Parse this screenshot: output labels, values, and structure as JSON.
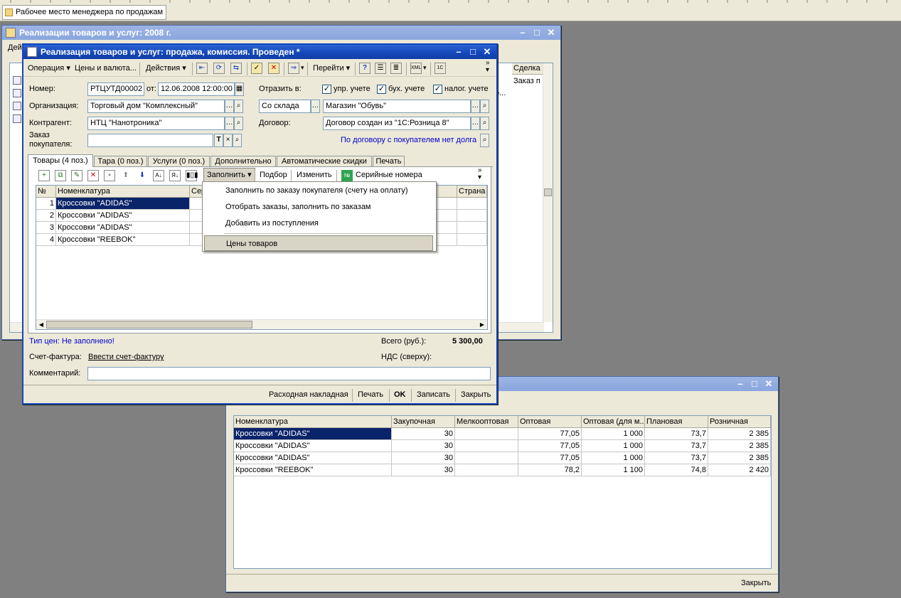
{
  "workplace_tab": "Рабочее место менеджера по продажам",
  "back_window": {
    "title": "Реализации товаров и услуг: 2008 г.",
    "menu_stub": "Дей",
    "col_deal": "Сделка",
    "deal_value": "Заказ п",
    "partial_text": "о..."
  },
  "main_window": {
    "title": "Реализация товаров и услуг: продажа, комиссия. Проведен *",
    "toolbar": {
      "operation": "Операция",
      "prices_currency": "Цены и валюта...",
      "actions": "Действия",
      "goto": "Перейти"
    },
    "form": {
      "number_label": "Номер:",
      "number_value": "РТЦУТД00002",
      "date_label": "от:",
      "date_value": "12.06.2008 12:00:00",
      "reflect_label": "Отразить в:",
      "check_mgmt": "упр. учете",
      "check_acc": "бух. учете",
      "check_tax": "налог. учете",
      "org_label": "Организация:",
      "org_value": "Торговый дом \"Комплексный\"",
      "warehouse_mode": "Со склада",
      "warehouse_value": "Магазин \"Обувь\"",
      "contractor_label": "Контрагент:",
      "contractor_value": "НТЦ \"Нанотроника\"",
      "contract_label": "Договор:",
      "contract_value": "Договор создан из \"1С:Розница 8\"",
      "order_label_1": "Заказ",
      "order_label_2": "покупателя:",
      "order_value": "",
      "debt_link": "По договору с покупателем нет долга"
    },
    "tabs": [
      "Товары (4 поз.)",
      "Тара (0 поз.)",
      "Услуги (0 поз.)",
      "Дополнительно",
      "Автоматические скидки",
      "Печать"
    ],
    "items_toolbar": {
      "fill": "Заполнить",
      "select": "Подбор",
      "edit": "Изменить",
      "serial": "Серийные номера"
    },
    "table": {
      "col_num": "№",
      "col_name": "Номенклатура",
      "col_serial": "Сер",
      "col_country": "Страна",
      "rows": [
        {
          "n": "1",
          "name": "Кроссовки \"ADIDAS\""
        },
        {
          "n": "2",
          "name": "Кроссовки \"ADIDAS\""
        },
        {
          "n": "3",
          "name": "Кроссовки \"ADIDAS\""
        },
        {
          "n": "4",
          "name": "Кроссовки \"REEBOK\""
        }
      ]
    },
    "fill_menu": [
      "Заполнить по заказу покупателя (счету на оплату)",
      "Отобрать заказы, заполнить по заказам",
      "Добавить из поступления",
      "Цены товаров"
    ],
    "footer": {
      "price_type": "Тип цен: Не заполнено!",
      "total_label": "Всего (руб.):",
      "total_value": "5 300,00",
      "invoice_label": "Счет-фактура:",
      "invoice_link": "Ввести счет-фактуру",
      "vat_label": "НДС (сверху):",
      "comment_label": "Комментарий:",
      "comment_value": ""
    },
    "bottom_buttons": {
      "waybill": "Расходная накладная",
      "print": "Печать",
      "ok": "OK",
      "save": "Записать",
      "close": "Закрыть"
    }
  },
  "prices_window": {
    "columns": [
      "Номенклатура",
      "Закупочная",
      "Мелкооптовая",
      "Оптовая",
      "Оптовая (для м...",
      "Плановая",
      "Розничная"
    ],
    "rows": [
      [
        "Кроссовки \"ADIDAS\"",
        "30",
        "",
        "77,05",
        "1 000",
        "73,7",
        "2 385"
      ],
      [
        "Кроссовки \"ADIDAS\"",
        "30",
        "",
        "77,05",
        "1 000",
        "73,7",
        "2 385"
      ],
      [
        "Кроссовки \"ADIDAS\"",
        "30",
        "",
        "77,05",
        "1 000",
        "73,7",
        "2 385"
      ],
      [
        "Кроссовки \"REEBOK\"",
        "30",
        "",
        "78,2",
        "1 100",
        "74,8",
        "2 420"
      ]
    ],
    "close": "Закрыть"
  }
}
